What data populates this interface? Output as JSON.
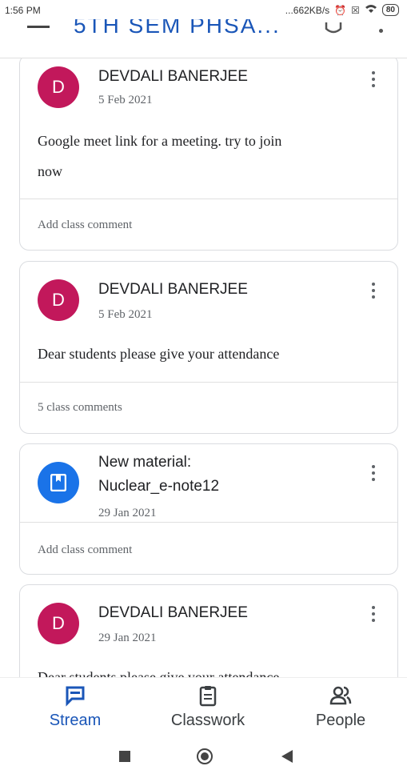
{
  "status_bar": {
    "time": "1:56 PM",
    "speed": "...662KB/s",
    "battery": "80"
  },
  "app_bar": {
    "title": "5TH SEM PHSA..."
  },
  "posts": [
    {
      "avatar_letter": "D",
      "author": "DEVDALI BANERJEE",
      "date": "5 Feb 2021",
      "text_line1": "Google meet link for a meeting. try to join",
      "text_line2": "now",
      "comment": "Add class comment"
    },
    {
      "avatar_letter": "D",
      "author": "DEVDALI BANERJEE",
      "date": "5 Feb 2021",
      "text_line1": "Dear students please give your attendance",
      "comment": "5 class comments"
    },
    {
      "type": "material",
      "title_line1": "New material:",
      "title_line2": "Nuclear_e-note12",
      "date": "29 Jan 2021",
      "comment": "Add class comment"
    },
    {
      "avatar_letter": "D",
      "author": "DEVDALI BANERJEE",
      "date": "29 Jan 2021",
      "text_line1": "Dear students please give your attendance"
    }
  ],
  "bottom_nav": [
    {
      "label": "Stream",
      "icon": "stream-icon",
      "active": true
    },
    {
      "label": "Classwork",
      "icon": "classwork-icon"
    },
    {
      "label": "People",
      "icon": "people-icon"
    }
  ],
  "colors": {
    "accent": "#1a56b8",
    "avatar": "#c2185b",
    "material": "#1a73e8"
  }
}
